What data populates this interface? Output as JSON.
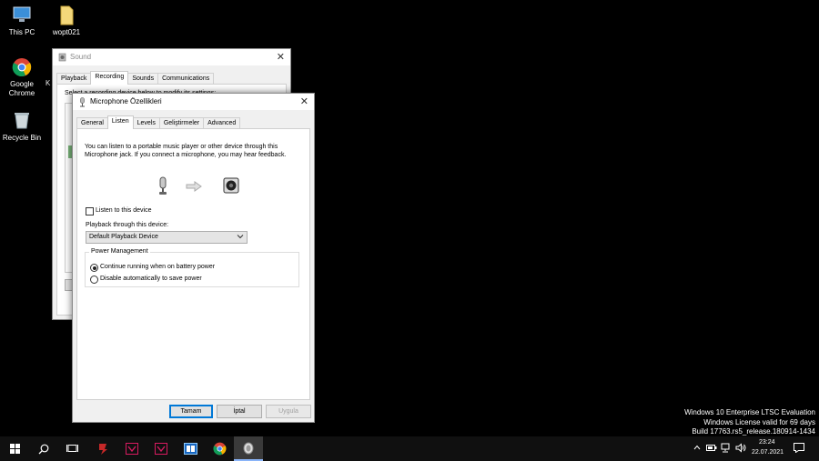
{
  "desktop": {
    "icons": [
      {
        "label": "This PC",
        "icon": "this-pc-icon"
      },
      {
        "label": "wopt021",
        "icon": "folder-icon"
      },
      {
        "label": "Google Chrome",
        "icon": "chrome-icon"
      },
      {
        "label": "Recycle Bin",
        "icon": "recycle-bin-icon"
      }
    ],
    "partial_label": "K"
  },
  "sound_window": {
    "title": "Sound",
    "tabs": [
      "Playback",
      "Recording",
      "Sounds",
      "Communications"
    ],
    "active_tab": "Recording",
    "partial_text": "Select a recording device below to modify its settings:"
  },
  "mic_dialog": {
    "title": "Microphone Özellikleri",
    "tabs": [
      "General",
      "Listen",
      "Levels",
      "Geliştirmeler",
      "Advanced"
    ],
    "active_tab": "Listen",
    "description": "You can listen to a portable music player or other device through this Microphone jack.  If you connect a microphone, you may hear feedback.",
    "listen_checkbox_label": "Listen to this device",
    "listen_checked": false,
    "playback_label": "Playback through this device:",
    "playback_selected": "Default Playback Device",
    "power_group_label": "Power Management",
    "power_options": [
      "Continue running when on battery power",
      "Disable automatically to save power"
    ],
    "power_selected_index": 0,
    "buttons": {
      "ok": "Tamam",
      "cancel": "İptal",
      "apply": "Uygula"
    }
  },
  "watermark": {
    "line1": "Windows 10 Enterprise LTSC Evaluation",
    "line2": "Windows License valid for 69 days",
    "line3": "Build 17763.rs5_release.180914-1434"
  },
  "taskbar": {
    "time": "23:24",
    "date": "22.07.2021",
    "accent": "#8ab4f8"
  }
}
